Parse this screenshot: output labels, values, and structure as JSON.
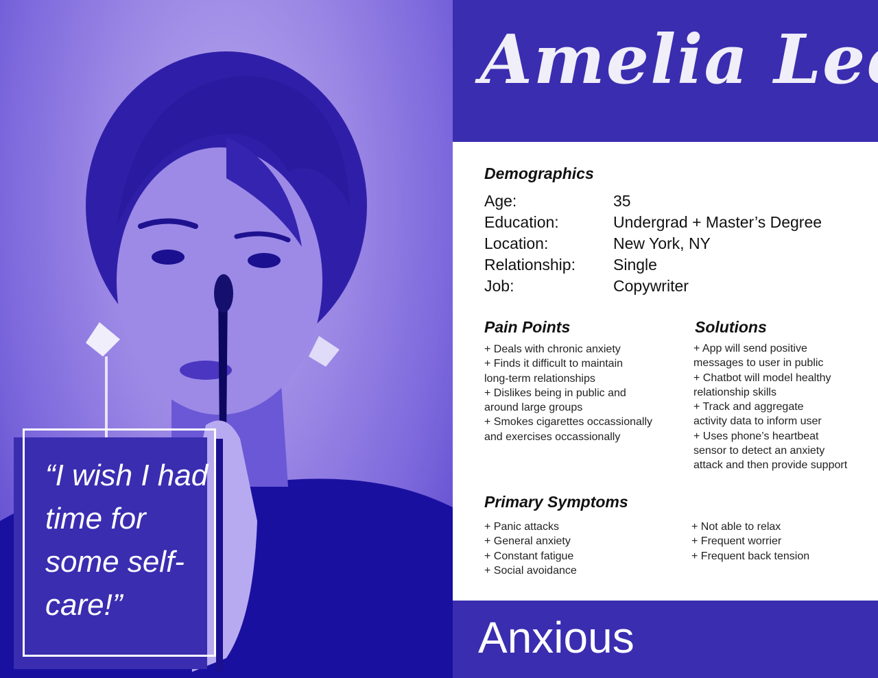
{
  "persona": {
    "name": "Amelia Lee",
    "quote": "“I wish I had time for some self-care!”",
    "type_label": "Anxious"
  },
  "demographics": {
    "title": "Demographics",
    "rows": [
      {
        "label": "Age:",
        "value": "35"
      },
      {
        "label": "Education:",
        "value": "Undergrad + Master’s Degree"
      },
      {
        "label": "Location:",
        "value": "New York, NY"
      },
      {
        "label": "Relationship:",
        "value": "Single"
      },
      {
        "label": "Job:",
        "value": "Copywriter"
      }
    ]
  },
  "pain_points": {
    "title": "Pain Points",
    "lines": [
      "+ Deals with chronic anxiety",
      "+ Finds it difficult to maintain",
      "long-term relationships",
      "+ Dislikes being in public and",
      "around large groups",
      "+ Smokes cigarettes occassionally",
      "and exercises occassionally"
    ]
  },
  "solutions": {
    "title": "Solutions",
    "lines": [
      "+ App will send positive",
      "messages to user in public",
      "+ Chatbot will model healthy",
      "relationship skills",
      "+ Track and aggregate",
      "activity data to inform user",
      "+ Uses phone’s heartbeat",
      "sensor to detect an anxiety",
      "attack and then provide support"
    ]
  },
  "symptoms": {
    "title": "Primary Symptoms",
    "col1": [
      "+ Panic attacks",
      "+ General anxiety",
      "+ Constant fatigue",
      "+ Social avoidance"
    ],
    "col2": [
      "+ Not able to relax",
      "+ Frequent worrier",
      "+ Frequent back tension"
    ]
  },
  "colors": {
    "brand": "#3a2db0",
    "photo_tint": "#7c68dc",
    "text": "#111111"
  },
  "icons": {
    "photo": "portrait-photo"
  }
}
